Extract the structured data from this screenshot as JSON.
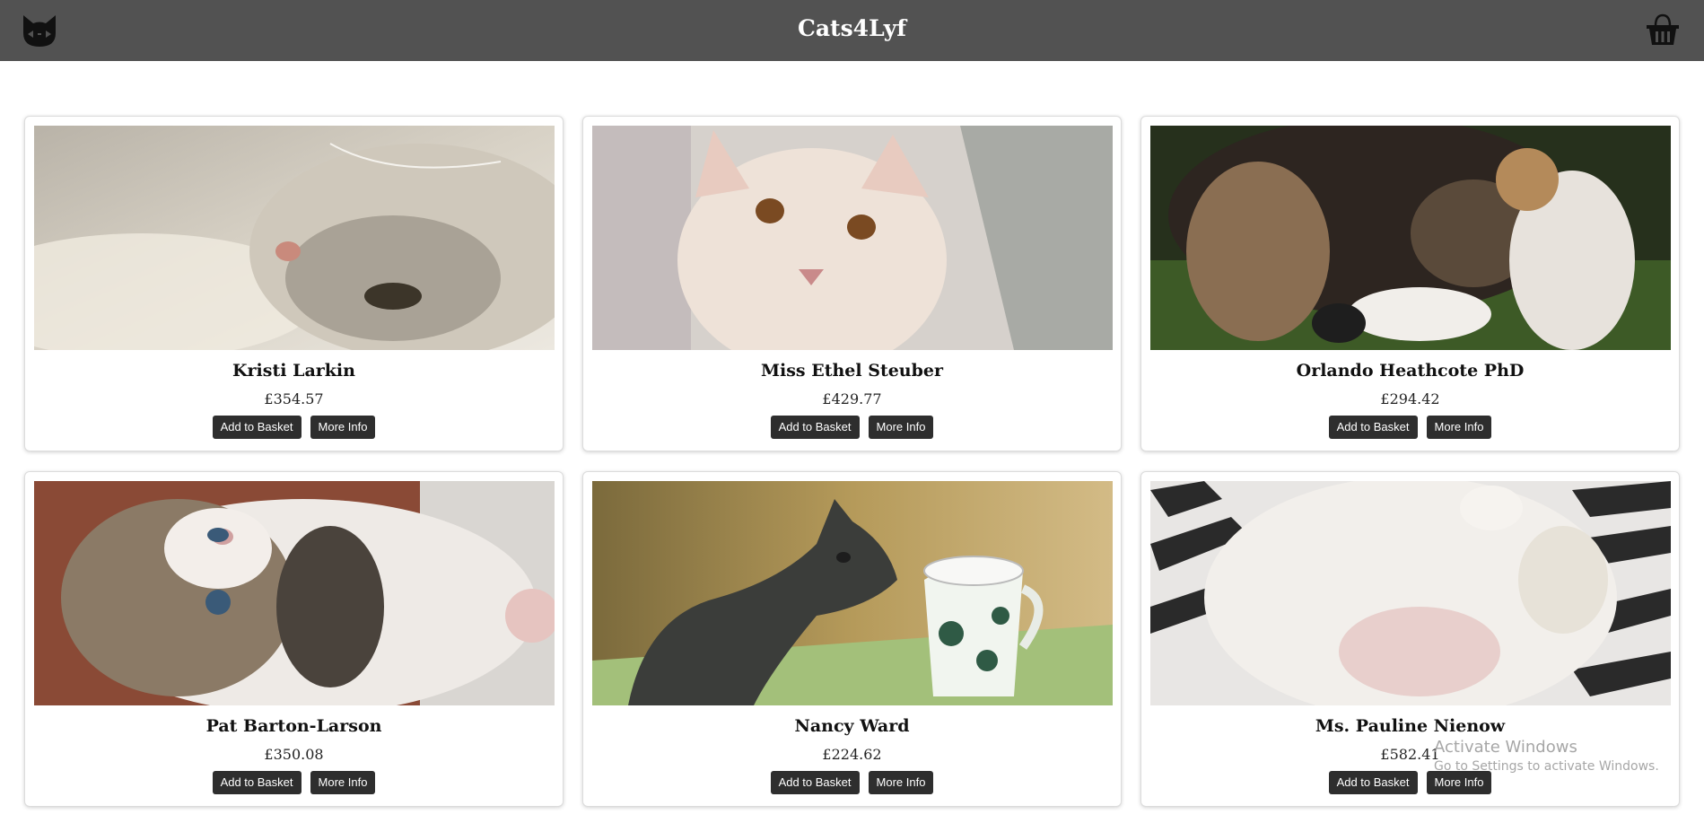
{
  "header": {
    "title": "Cats4Lyf",
    "background": "#525252",
    "logo_icon": "cat-face-icon",
    "basket_icon": "basket-icon"
  },
  "cats": [
    {
      "name": "Kristi Larkin",
      "price": "£354.57",
      "add_label": "Add to Basket",
      "info_label": "More Info"
    },
    {
      "name": "Miss Ethel Steuber",
      "price": "£429.77",
      "add_label": "Add to Basket",
      "info_label": "More Info"
    },
    {
      "name": "Orlando Heathcote PhD",
      "price": "£294.42",
      "add_label": "Add to Basket",
      "info_label": "More Info"
    },
    {
      "name": "Pat Barton-Larson",
      "price": "£350.08",
      "add_label": "Add to Basket",
      "info_label": "More Info"
    },
    {
      "name": "Nancy Ward",
      "price": "£224.62",
      "add_label": "Add to Basket",
      "info_label": "More Info"
    },
    {
      "name": "Ms. Pauline Nienow",
      "price": "£582.41",
      "add_label": "Add to Basket",
      "info_label": "More Info"
    }
  ],
  "watermark": {
    "title": "Activate Windows",
    "subtitle": "Go to Settings to activate Windows."
  },
  "colors": {
    "button": "#2e2e2e",
    "card_border": "#dcdcdc"
  }
}
